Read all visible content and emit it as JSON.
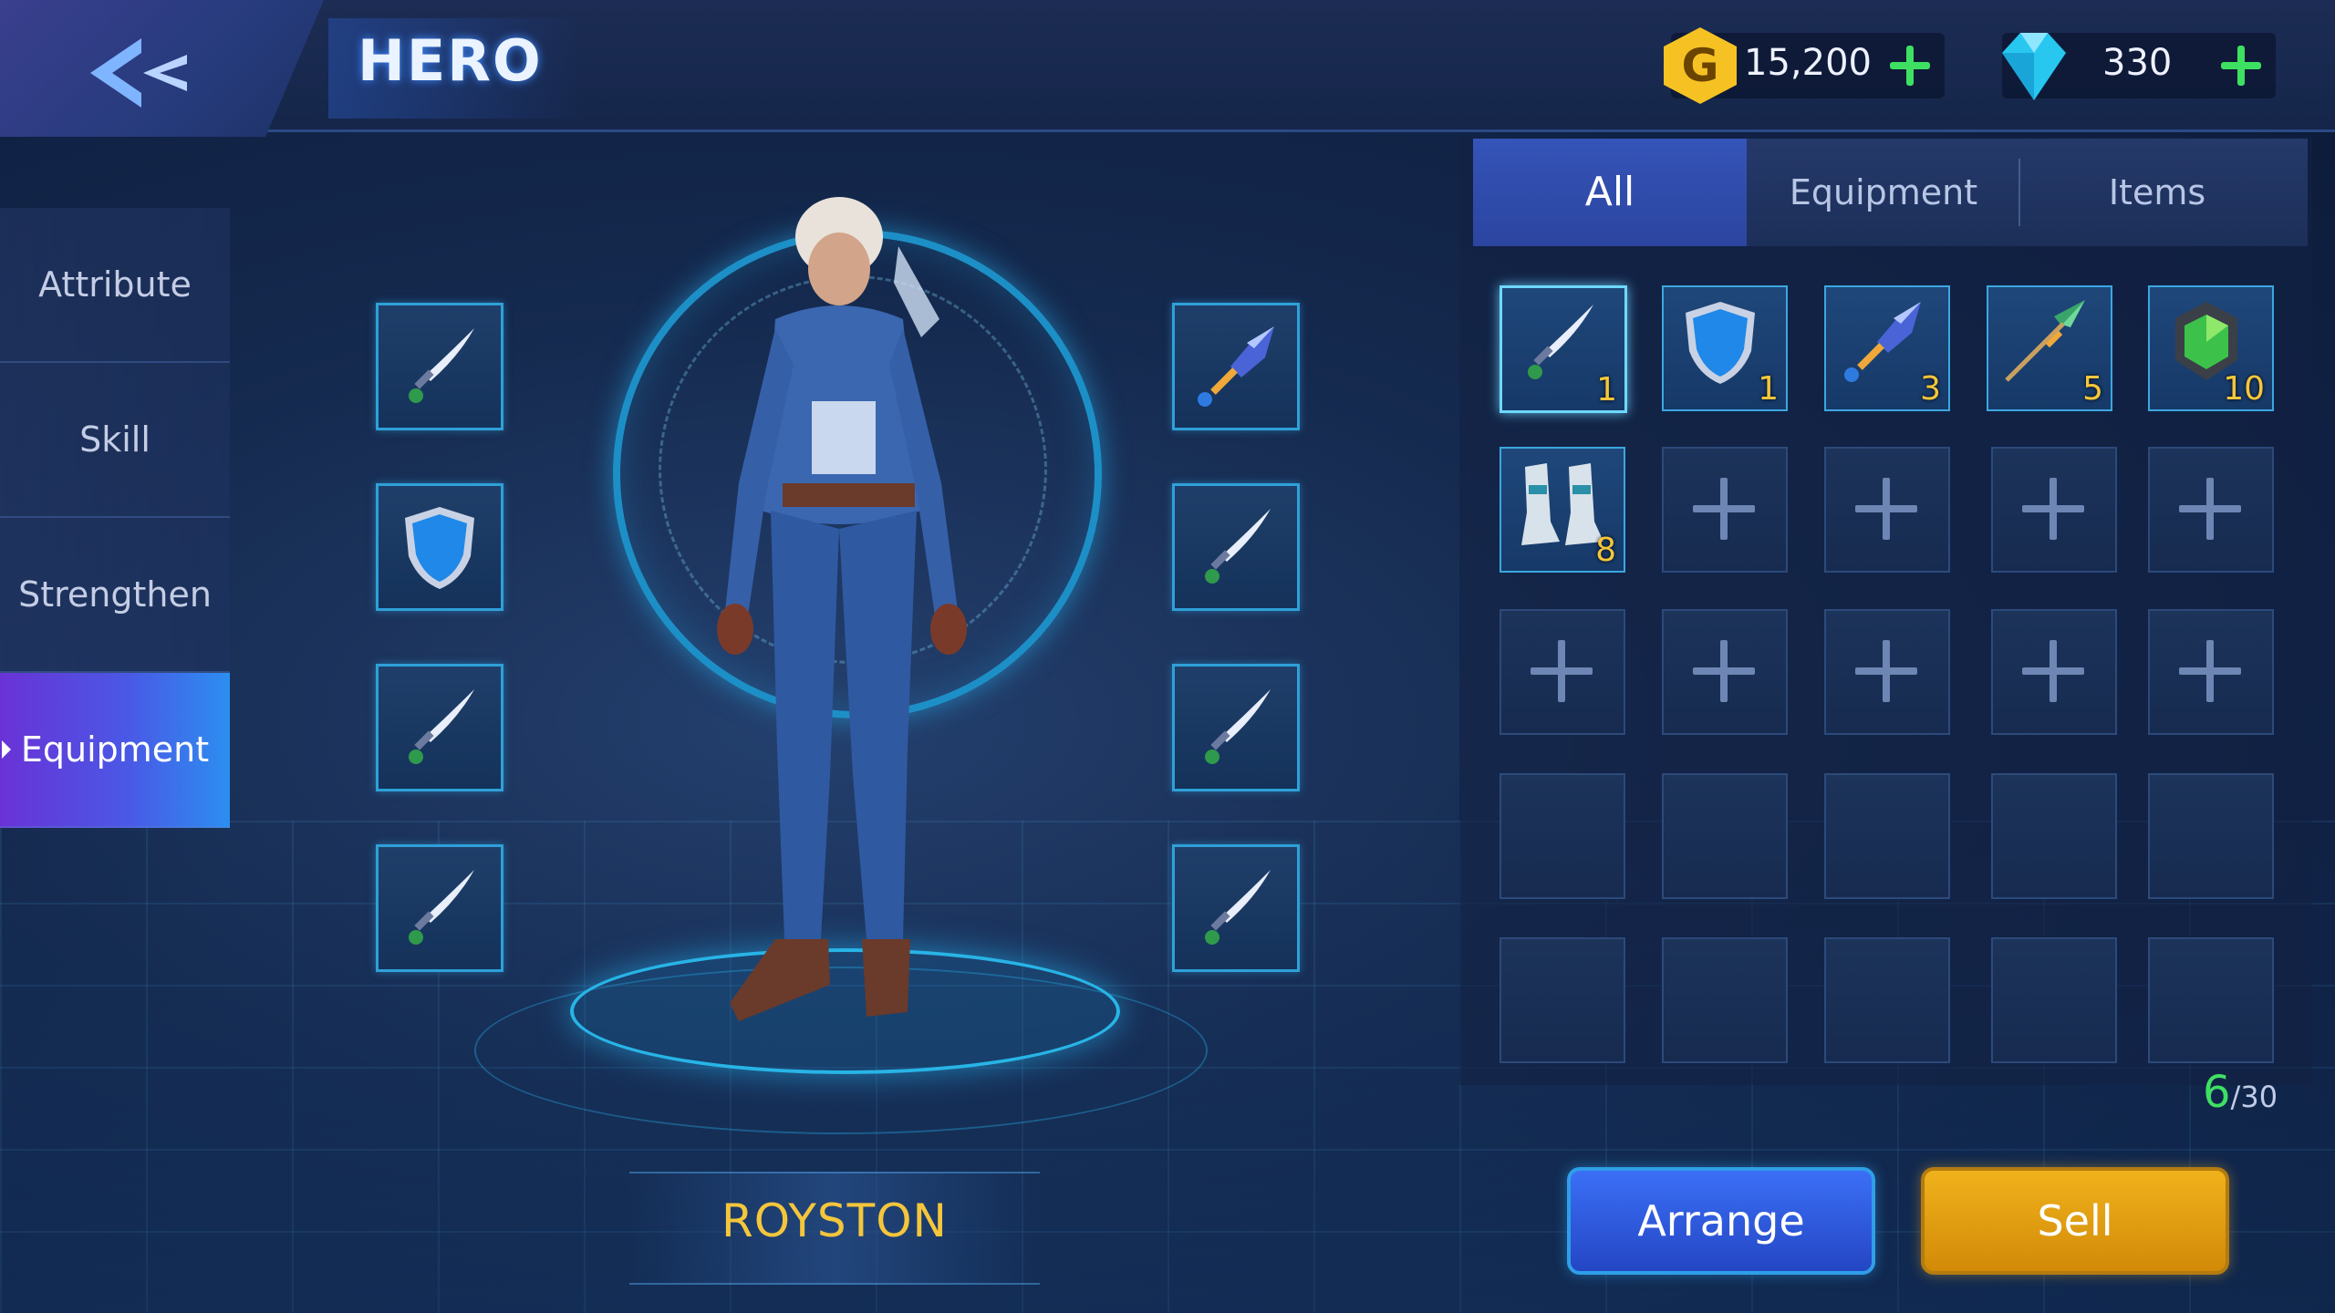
{
  "header": {
    "title": "HERO",
    "back_icon": "chevron-left-icon",
    "gold": {
      "icon": "gold-coin-icon",
      "icon_letter": "G",
      "value": "15,200"
    },
    "gems": {
      "icon": "diamond-icon",
      "value": "330"
    }
  },
  "sidebar": {
    "items": [
      {
        "label": "Attribute",
        "active": false
      },
      {
        "label": "Skill",
        "active": false
      },
      {
        "label": "Strengthen",
        "active": false
      },
      {
        "label": "Equipment",
        "active": true
      }
    ]
  },
  "hero": {
    "name": "ROYSTON",
    "left_slots": [
      "dagger-icon",
      "shield-icon",
      "dagger-icon",
      "dagger-icon"
    ],
    "right_slots": [
      "sword-icon",
      "dagger-icon",
      "dagger-icon",
      "dagger-icon"
    ]
  },
  "inventory": {
    "tabs": [
      {
        "label": "All",
        "active": true
      },
      {
        "label": "Equipment",
        "active": false
      },
      {
        "label": "Items",
        "active": false
      }
    ],
    "items": [
      {
        "icon": "dagger-icon",
        "qty": "1"
      },
      {
        "icon": "shield-icon",
        "qty": "1"
      },
      {
        "icon": "sword-icon",
        "qty": "3"
      },
      {
        "icon": "spear-icon",
        "qty": "5"
      },
      {
        "icon": "armor-icon",
        "qty": "10"
      },
      {
        "icon": "boots-icon",
        "qty": "8"
      }
    ],
    "capacity_current": "6",
    "capacity_max": "/30"
  },
  "actions": {
    "arrange": "Arrange",
    "sell": "Sell"
  },
  "colors": {
    "accent": "#2fa0d8",
    "gold": "#f5c63b",
    "green": "#3ee062",
    "active_tab": "#3554b8"
  }
}
